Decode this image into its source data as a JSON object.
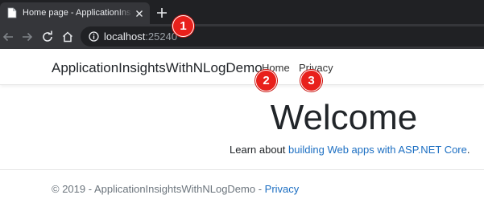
{
  "browser": {
    "tab_title": "Home page - ApplicationInsightsWithNLogDemo",
    "url_host": "localhost",
    "url_port": ":25240",
    "icons": {
      "favicon": "page-icon",
      "close": "close-icon",
      "new_tab": "plus-icon",
      "back": "arrow-left-icon",
      "forward": "arrow-right-icon",
      "reload": "reload-icon",
      "home": "home-icon",
      "site_info": "info-icon"
    }
  },
  "callouts": [
    "1",
    "2",
    "3"
  ],
  "navbar": {
    "brand": "ApplicationInsightsWithNLogDemo",
    "links": [
      "Home",
      "Privacy"
    ]
  },
  "main": {
    "heading": "Welcome",
    "learn_prefix": "Learn about ",
    "learn_link": "building Web apps with ASP.NET Core",
    "learn_suffix": "."
  },
  "footer": {
    "text": "© 2019 - ApplicationInsightsWithNLogDemo - ",
    "link": "Privacy"
  },
  "colors": {
    "chrome_dark": "#202124",
    "chrome_tab": "#35363a",
    "callout": "#e8201b",
    "link": "#1b6ec2"
  }
}
